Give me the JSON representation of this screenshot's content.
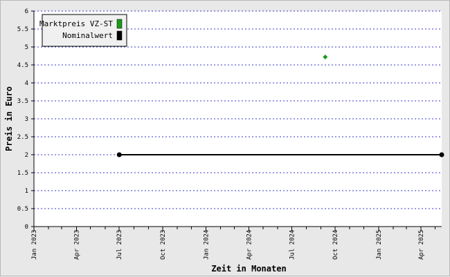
{
  "chart_data": {
    "type": "line",
    "xlabel": "Zeit in Monaten",
    "ylabel": "Preis in Euro",
    "xlim": [
      "2023-01-01",
      "2025-05-15"
    ],
    "ylim": [
      0,
      6
    ],
    "yticks": [
      0,
      0.5,
      1,
      1.5,
      2,
      2.5,
      3,
      3.5,
      4,
      4.5,
      5,
      5.5,
      6
    ],
    "xticks": [
      {
        "label": "Jan 2023",
        "date": "2023-01-01"
      },
      {
        "label": "Apr 2023",
        "date": "2023-04-01"
      },
      {
        "label": "Jul 2023",
        "date": "2023-07-01"
      },
      {
        "label": "Oct 2023",
        "date": "2023-10-01"
      },
      {
        "label": "Jan 2024",
        "date": "2024-01-01"
      },
      {
        "label": "Apr 2024",
        "date": "2024-04-01"
      },
      {
        "label": "Jul 2024",
        "date": "2024-07-01"
      },
      {
        "label": "Oct 2024",
        "date": "2024-10-01"
      },
      {
        "label": "Jan 2025",
        "date": "2025-01-01"
      },
      {
        "label": "Apr 2025",
        "date": "2025-04-01"
      }
    ],
    "grid": true,
    "legend_position": "top-left",
    "series": [
      {
        "name": "Marktpreis VZ-ST",
        "color": "#1a9a1a",
        "marker": "diamond",
        "points": [
          {
            "x": "2024-09-10",
            "y": 4.72
          }
        ]
      },
      {
        "name": "Nominalwert",
        "color": "#000000",
        "marker": "circle",
        "points": [
          {
            "x": "2023-07-01",
            "y": 2.0
          },
          {
            "x": "2025-05-15",
            "y": 2.0
          }
        ]
      }
    ]
  }
}
